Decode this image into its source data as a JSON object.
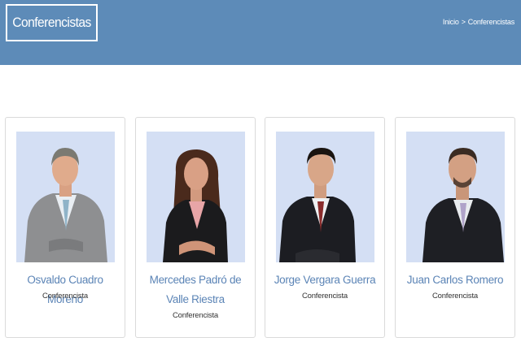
{
  "header": {
    "title": "Conferencistas",
    "breadcrumb": {
      "home": "Inicio",
      "separator": ">",
      "current": "Conferencistas"
    },
    "background_color": "#5d8bb8"
  },
  "speakers": [
    {
      "name": "Osvaldo Cuadro Moreno",
      "role": "Conferencista"
    },
    {
      "name": "Mercedes Padró de Valle Riestra",
      "role": "Conferencista"
    },
    {
      "name": "Jorge Vergara Guerra",
      "role": "Conferencista"
    },
    {
      "name": "Juan Carlos Romero",
      "role": "Conferencista"
    }
  ],
  "colors": {
    "accent": "#5b84b6",
    "photo_bg": "#d4dff4"
  }
}
